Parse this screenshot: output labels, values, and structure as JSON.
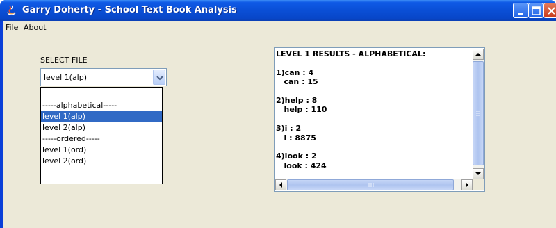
{
  "window": {
    "title": "Garry Doherty - School Text Book Analysis"
  },
  "menu": {
    "items": [
      {
        "label": "File"
      },
      {
        "label": "About"
      }
    ]
  },
  "file_select": {
    "label": "SELECT FILE",
    "selected_value": "level 1(alp)",
    "options": [
      {
        "label": ""
      },
      {
        "label": "-----alphabetical-----"
      },
      {
        "label": "level 1(alp)",
        "selected": true
      },
      {
        "label": "level 2(alp)"
      },
      {
        "label": "-----ordered-----"
      },
      {
        "label": "level 1(ord)"
      },
      {
        "label": "level 2(ord)"
      }
    ]
  },
  "results": {
    "text": "LEVEL 1 RESULTS - ALPHABETICAL:\n\n1)can : 4\n   can : 15\n\n2)help : 8\n   help : 110\n\n3)i : 2\n   i : 8875\n\n4)look : 2\n   look : 424"
  },
  "colors": {
    "titlebar": "#0a4fd6",
    "client_bg": "#ece9d8",
    "selection": "#316ac5",
    "close_button": "#c8391b"
  }
}
